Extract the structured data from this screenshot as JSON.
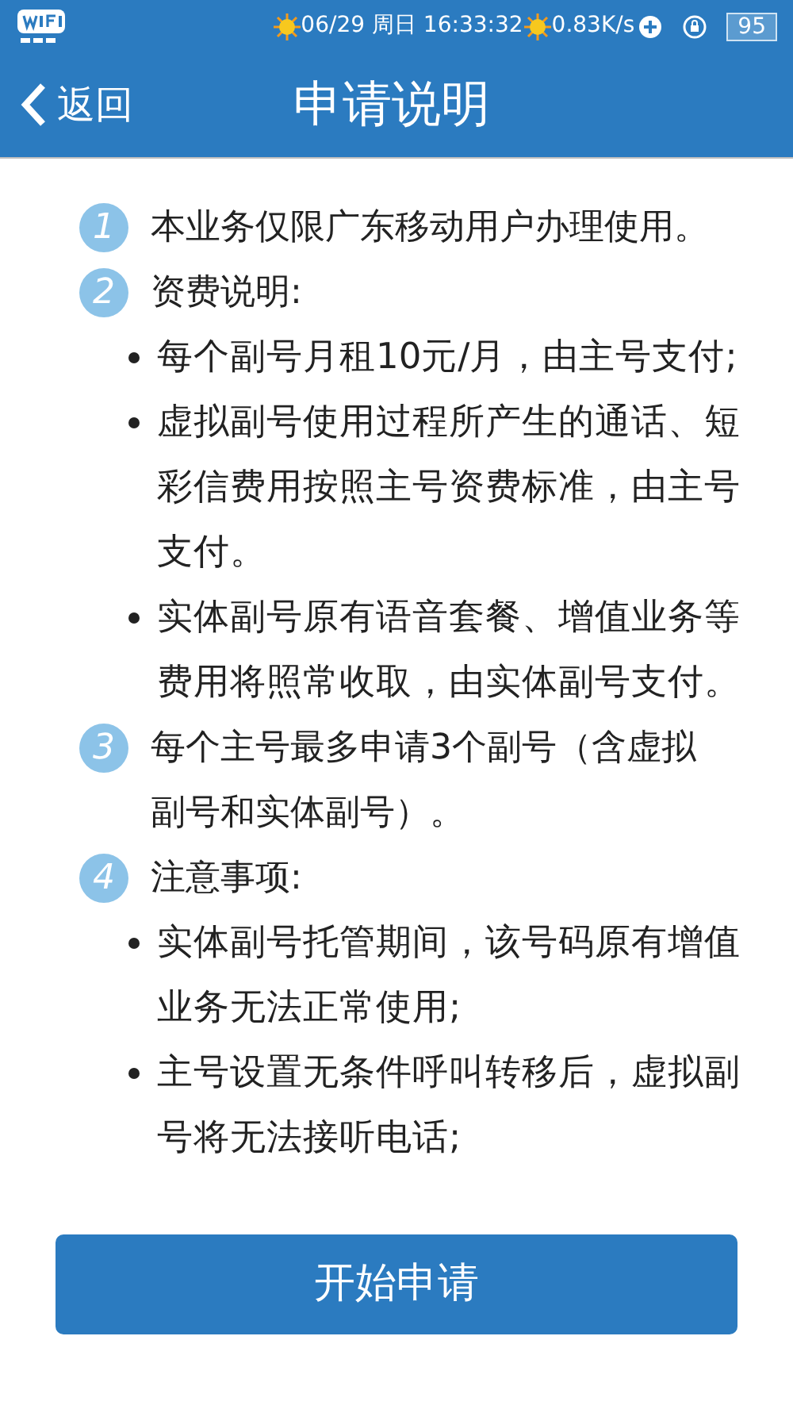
{
  "status_bar": {
    "date": "06/29 周日 16:33:32",
    "speed": "0.83K/s",
    "battery": "95"
  },
  "header": {
    "back": "返回",
    "title": "申请说明"
  },
  "items": [
    {
      "number": "1",
      "text": "本业务仅限广东移动用户办理使用。"
    },
    {
      "number": "2",
      "text": "资费说明:",
      "children": [
        {
          "text": "每个副号月租10元/月，由主号支付;"
        },
        {
          "text": "虚拟副号使用过程所产生的通话、短彩信费用按照主号资费标准，由主号支付。"
        },
        {
          "text": "实体副号原有语音套餐、增值业务等费用将照常收取，由实体副号支付。"
        }
      ]
    },
    {
      "number": "3",
      "text": "每个主号最多申请3个副号（含虚拟副号和实体副号）。"
    },
    {
      "number": "4",
      "text": "注意事项:",
      "children": [
        {
          "text": "实体副号托管期间，该号码原有增值业务无法正常使用;"
        },
        {
          "text": "主号设置无条件呼叫转移后，虚拟副号将无法接听电话;"
        }
      ]
    }
  ],
  "button": "开始申请"
}
